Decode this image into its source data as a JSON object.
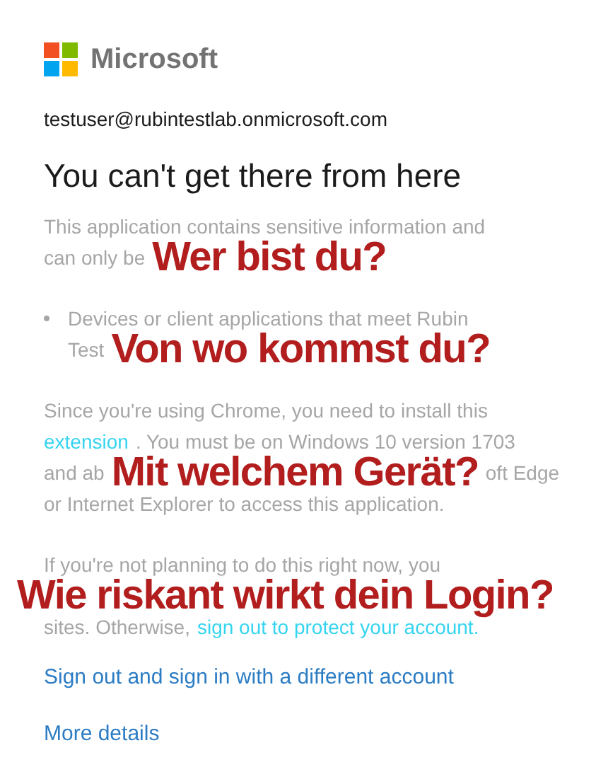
{
  "brand": {
    "name": "Microsoft"
  },
  "account": "testuser@rubintestlab.onmicrosoft.com",
  "title": "You can't get there from here",
  "paragraphs": [
    {
      "kind": "text",
      "lines": [
        [
          {
            "kind": "plain",
            "text": "This application contains sensitive information and"
          }
        ],
        [
          {
            "kind": "plain",
            "text": "can only be"
          },
          {
            "kind": "caption",
            "text": "Wer bist du?"
          }
        ]
      ]
    },
    {
      "kind": "bullet",
      "lines": [
        [
          {
            "kind": "plain",
            "text": "Devices or client applications that meet Rubin"
          }
        ],
        [
          {
            "kind": "plain",
            "text": "Test"
          },
          {
            "kind": "caption",
            "text": "Von wo kommst du?"
          }
        ]
      ]
    },
    {
      "kind": "text",
      "lines": [
        [
          {
            "kind": "plain",
            "text": "Since you're using Chrome, you need to install this"
          }
        ],
        [
          {
            "kind": "link",
            "text": "extension"
          },
          {
            "kind": "plain",
            "text": ". You must be on Windows 10 version 1703"
          }
        ],
        [
          {
            "kind": "plain",
            "text": "and ab"
          },
          {
            "kind": "caption",
            "text": "Mit welchem Gerät?"
          },
          {
            "kind": "plain",
            "text": "oft Edge"
          }
        ],
        [
          {
            "kind": "plain",
            "text": "or Internet Explorer to access this application."
          }
        ]
      ]
    },
    {
      "kind": "text",
      "lines": [
        [
          {
            "kind": "plain",
            "text": "If you're not planning to do this right now, you"
          }
        ],
        [
          {
            "kind": "caption",
            "text": "Wie riskant wirkt dein Login?"
          }
        ],
        [
          {
            "kind": "plain",
            "text": "sites. Otherwise,"
          },
          {
            "kind": "link",
            "text": "sign out to protect your account."
          }
        ]
      ]
    }
  ],
  "links": [
    "Sign out and sign in with a different account",
    "More details"
  ]
}
